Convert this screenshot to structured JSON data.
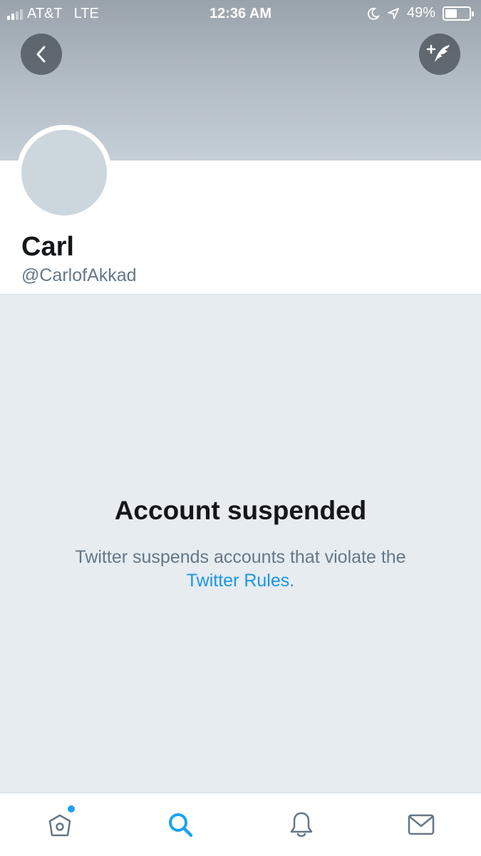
{
  "status_bar": {
    "carrier": "AT&T",
    "network": "LTE",
    "time": "12:36 AM",
    "battery": "49%",
    "battery_level": 0.49
  },
  "header": {
    "back_icon": "chevron-left-icon",
    "compose_icon": "compose-tweet-icon"
  },
  "profile": {
    "name": "Carl",
    "handle": "@CarlofAkkad"
  },
  "suspension": {
    "title": "Account suspended",
    "message": "Twitter suspends accounts that violate the",
    "link_text": "Twitter Rules",
    "trailing": "."
  },
  "tab_bar": {
    "tabs": [
      {
        "name": "home",
        "icon": "home-icon",
        "has_notification_dot": true
      },
      {
        "name": "search",
        "icon": "search-icon",
        "active": true
      },
      {
        "name": "notifications",
        "icon": "bell-icon"
      },
      {
        "name": "messages",
        "icon": "envelope-icon"
      }
    ]
  },
  "colors": {
    "accent": "#1da1f2",
    "link": "#1b95e0",
    "banner": "#b3bcc4",
    "suspended_bg": "#e6ecf0",
    "text_primary": "#14171a",
    "text_secondary": "#657786"
  }
}
